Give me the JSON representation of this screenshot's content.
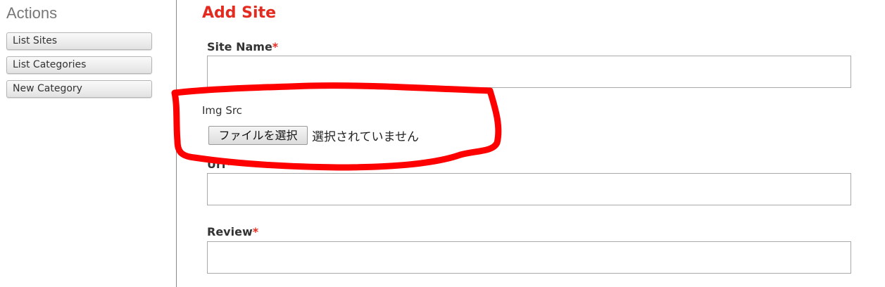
{
  "sidebar": {
    "title": "Actions",
    "items": [
      {
        "label": "List Sites"
      },
      {
        "label": "List Categories"
      },
      {
        "label": "New Category"
      }
    ]
  },
  "main": {
    "title": "Add Site",
    "fields": {
      "site_name": {
        "label": "Site Name",
        "required_mark": "*",
        "value": ""
      },
      "img_src": {
        "label": "Img Src",
        "button_label": "ファイルを選択",
        "status": "選択されていません"
      },
      "url": {
        "label": "Url",
        "required_mark": "*",
        "value": ""
      },
      "review": {
        "label": "Review",
        "required_mark": "*",
        "value": ""
      }
    }
  },
  "annotation": {
    "color": "#ff0000",
    "shape": "hand-drawn-outline"
  },
  "colors": {
    "accent": "#e32b20",
    "text": "#333333",
    "sidebar_title": "#777777"
  }
}
